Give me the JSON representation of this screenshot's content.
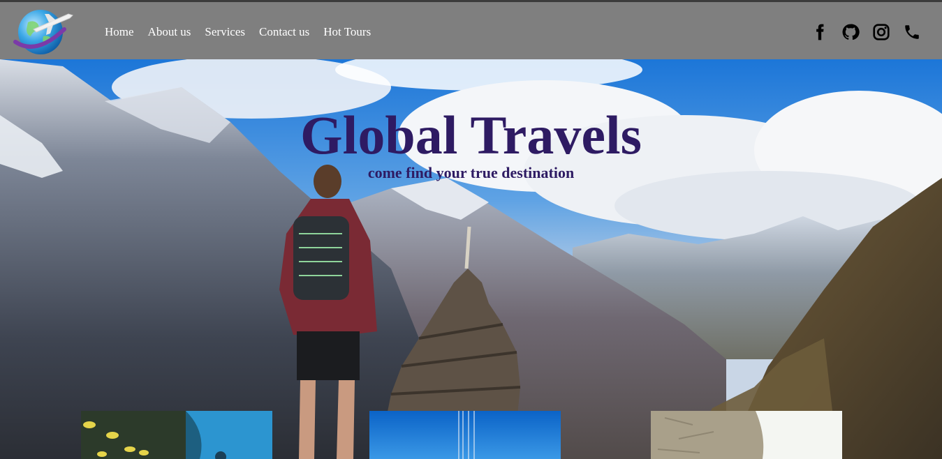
{
  "nav": {
    "logo": "globe-airplane-logo",
    "links": [
      {
        "label": "Home"
      },
      {
        "label": "About us"
      },
      {
        "label": "Services"
      },
      {
        "label": "Contact us"
      },
      {
        "label": "Hot Tours"
      }
    ],
    "social": [
      "facebook-icon",
      "github-icon",
      "instagram-icon",
      "phone-icon"
    ]
  },
  "hero": {
    "title": "Global Travels",
    "subtitle": "come find your true destination"
  },
  "colors": {
    "navbar_bg": "#7f7f7f",
    "nav_text": "#ffffff",
    "hero_text": "#2e1b63"
  },
  "cards": [
    "underwater-fish-image",
    "blue-sky-image",
    "stone-wall-image"
  ]
}
